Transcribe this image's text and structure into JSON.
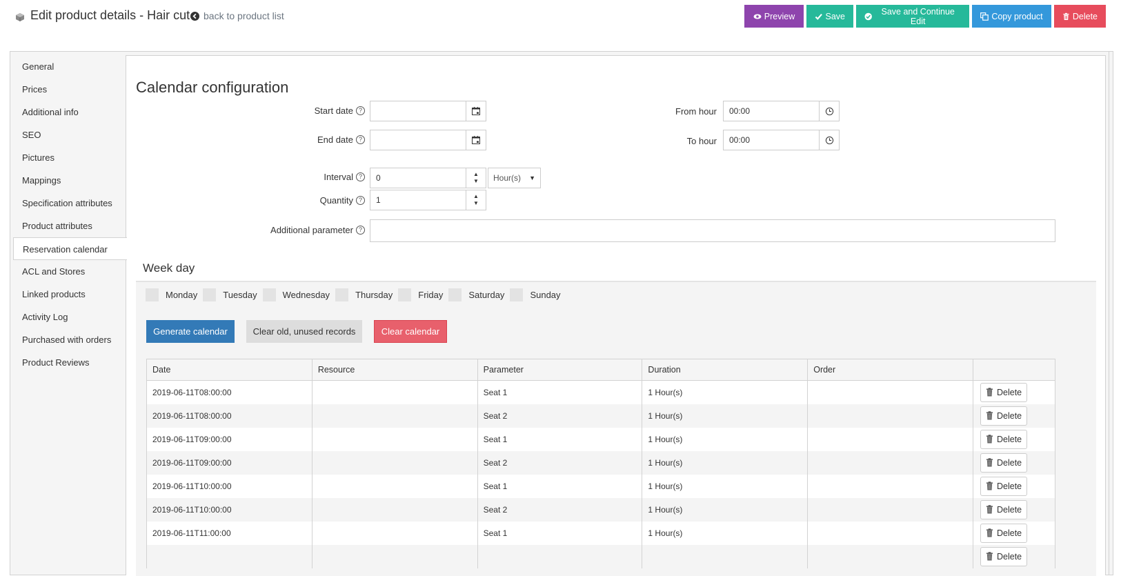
{
  "header": {
    "title": "Edit product details - Hair cut",
    "back_link": "back to product list",
    "buttons": {
      "preview": "Preview",
      "save": "Save",
      "save_continue": "Save and Continue Edit",
      "copy": "Copy product",
      "delete": "Delete"
    }
  },
  "colors": {
    "preview": "#8e44ad",
    "save": "#26b99a",
    "copy": "#3498db",
    "delete": "#e74c5c",
    "generate": "#337ab7",
    "clear_calendar": "#e8606c"
  },
  "sidebar": {
    "items": [
      {
        "label": "General"
      },
      {
        "label": "Prices"
      },
      {
        "label": "Additional info"
      },
      {
        "label": "SEO"
      },
      {
        "label": "Pictures"
      },
      {
        "label": "Mappings"
      },
      {
        "label": "Specification attributes"
      },
      {
        "label": "Product attributes"
      },
      {
        "label": "Reservation calendar",
        "active": true
      },
      {
        "label": "ACL and Stores"
      },
      {
        "label": "Linked products"
      },
      {
        "label": "Activity Log"
      },
      {
        "label": "Purchased with orders"
      },
      {
        "label": "Product Reviews"
      }
    ]
  },
  "calendar_config": {
    "title": "Calendar configuration",
    "start_date": {
      "label": "Start date",
      "value": ""
    },
    "end_date": {
      "label": "End date",
      "value": ""
    },
    "from_hour": {
      "label": "From hour",
      "value": "00:00"
    },
    "to_hour": {
      "label": "To hour",
      "value": "00:00"
    },
    "interval": {
      "label": "Interval",
      "value": "0",
      "unit": "Hour(s)"
    },
    "quantity": {
      "label": "Quantity",
      "value": "1"
    },
    "additional_parameter": {
      "label": "Additional parameter",
      "value": ""
    }
  },
  "week_day": {
    "title": "Week day",
    "days": [
      "Monday",
      "Tuesday",
      "Wednesday",
      "Thursday",
      "Friday",
      "Saturday",
      "Sunday"
    ],
    "generate_label": "Generate calendar",
    "clear_old_label": "Clear old, unused records",
    "clear_calendar_label": "Clear calendar"
  },
  "table": {
    "columns": [
      "Date",
      "Resource",
      "Parameter",
      "Duration",
      "Order",
      ""
    ],
    "delete_label": "Delete",
    "rows": [
      {
        "date": "2019-06-11T08:00:00",
        "resource": "",
        "parameter": "Seat 1",
        "duration": "1 Hour(s)",
        "order": ""
      },
      {
        "date": "2019-06-11T08:00:00",
        "resource": "",
        "parameter": "Seat 2",
        "duration": "1 Hour(s)",
        "order": ""
      },
      {
        "date": "2019-06-11T09:00:00",
        "resource": "",
        "parameter": "Seat 1",
        "duration": "1 Hour(s)",
        "order": ""
      },
      {
        "date": "2019-06-11T09:00:00",
        "resource": "",
        "parameter": "Seat 2",
        "duration": "1 Hour(s)",
        "order": ""
      },
      {
        "date": "2019-06-11T10:00:00",
        "resource": "",
        "parameter": "Seat 1",
        "duration": "1 Hour(s)",
        "order": ""
      },
      {
        "date": "2019-06-11T10:00:00",
        "resource": "",
        "parameter": "Seat 2",
        "duration": "1 Hour(s)",
        "order": ""
      },
      {
        "date": "2019-06-11T11:00:00",
        "resource": "",
        "parameter": "Seat 1",
        "duration": "1 Hour(s)",
        "order": ""
      },
      {
        "date": "",
        "resource": "",
        "parameter": "",
        "duration": "",
        "order": ""
      }
    ]
  }
}
